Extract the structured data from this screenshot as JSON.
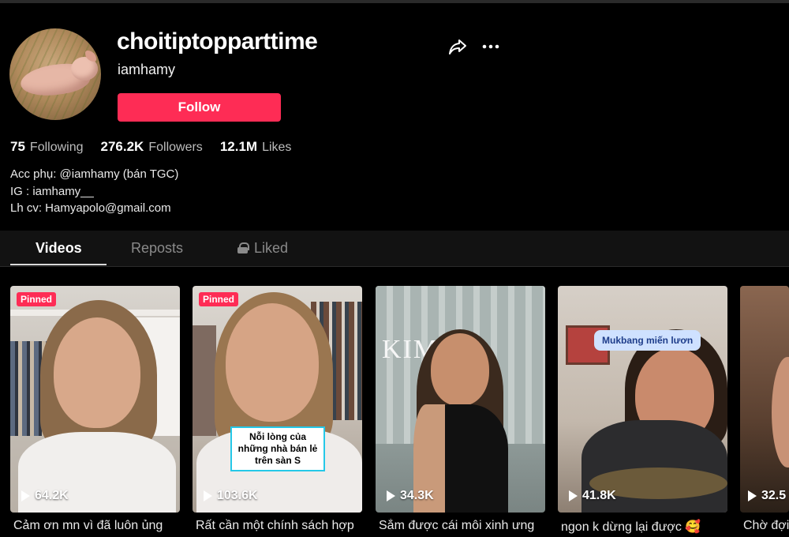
{
  "profile": {
    "username": "choitiptopparttime",
    "nickname": "iamhamy",
    "follow_label": "Follow",
    "stats": {
      "following_count": "75",
      "following_label": "Following",
      "followers_count": "276.2K",
      "followers_label": "Followers",
      "likes_count": "12.1M",
      "likes_label": "Likes"
    },
    "bio": [
      "Acc phụ: @iamhamy (bán TGC)",
      "IG : iamhamy__",
      "Lh cv: Hamyapolo@gmail.com"
    ]
  },
  "tabs": [
    "Videos",
    "Reposts",
    "Liked"
  ],
  "videos": [
    {
      "pinned": "Pinned",
      "views": "64.2K",
      "caption": "Cảm ơn mn vì đã luôn ủng"
    },
    {
      "pinned": "Pinned",
      "views": "103.6K",
      "caption": "Rất cần một chính sách hợp",
      "overlay": "Nỗi lòng của những nhà bán lẻ trên sàn S"
    },
    {
      "views": "34.3K",
      "caption": "Sắm được cái môi xinh ưng",
      "sign": "KIM"
    },
    {
      "views": "41.8K",
      "caption": "ngon k dừng lại được 🥰",
      "overlay": "Mukbang miến lươn"
    },
    {
      "views": "32.5",
      "caption": "Chờ đợi"
    }
  ],
  "colors": {
    "accent": "#fe2c55",
    "background": "#000000",
    "tabs_bg": "#121212"
  },
  "icons": {
    "share": "share-arrow-icon",
    "more": "more-dots-icon",
    "lock": "lock-icon",
    "play": "play-icon"
  }
}
